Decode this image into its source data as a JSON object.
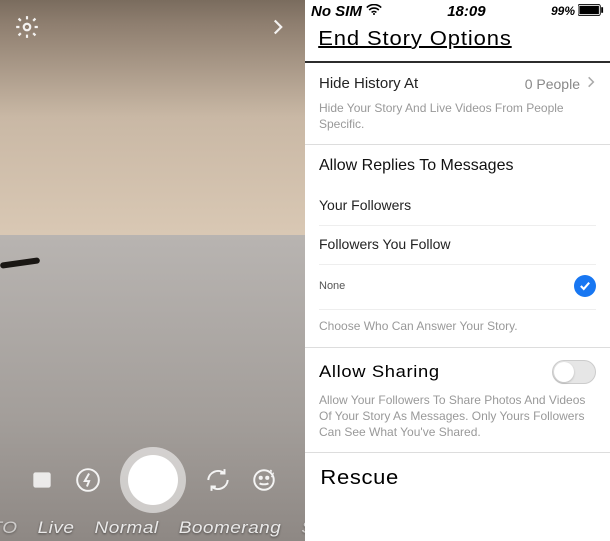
{
  "status": {
    "carrier": "No SIM",
    "time": "18:09",
    "battery_pct": "99%"
  },
  "settings": {
    "title": "End Story Options",
    "hide": {
      "label": "Hide History At",
      "value": "0 People",
      "helper": "Hide Your Story And Live Videos From People Specific."
    },
    "replies": {
      "heading": "Allow Replies To Messages",
      "opt1": "Your Followers",
      "opt2": "Followers You Follow",
      "opt3": "None",
      "helper": "Choose Who Can Answer Your Story."
    },
    "sharing": {
      "heading": "Allow Sharing",
      "helper": "Allow Your Followers To Share Photos And Videos Of Your Story As Messages. Only Yours Followers Can See What You've Shared."
    },
    "rescue": "Rescue"
  },
  "camera": {
    "modes": {
      "m0": "TO",
      "m1": "Live",
      "m2": "Normal",
      "m3": "Boomerang",
      "m4": "S"
    }
  }
}
